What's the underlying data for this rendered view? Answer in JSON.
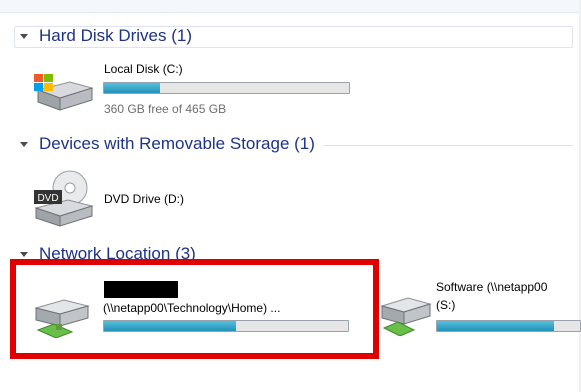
{
  "groups": {
    "hdd": {
      "title": "Hard Disk Drives (1)",
      "items": [
        {
          "name": "Local Disk (C:)",
          "sub": "360 GB free of 465 GB",
          "used_fraction": 0.23
        }
      ]
    },
    "removable": {
      "title": "Devices with Removable Storage (1)",
      "items": [
        {
          "name": "DVD Drive (D:)"
        }
      ]
    },
    "network": {
      "title": "Network Location (3)",
      "items": [
        {
          "name": "(\\\\netapp00\\Technology\\Home) ...",
          "used_fraction": 0.54
        },
        {
          "name": "Software (\\\\netapp00",
          "drive": "(S:)",
          "used_fraction": 0.82
        }
      ]
    }
  },
  "colors": {
    "header_text": "#1e3287",
    "bar_fill": "#2590b8",
    "highlight": "#e00000"
  },
  "icons": {
    "hdd": "hard-drive-windows-icon",
    "dvd": "dvd-drive-icon",
    "network": "network-drive-icon"
  }
}
